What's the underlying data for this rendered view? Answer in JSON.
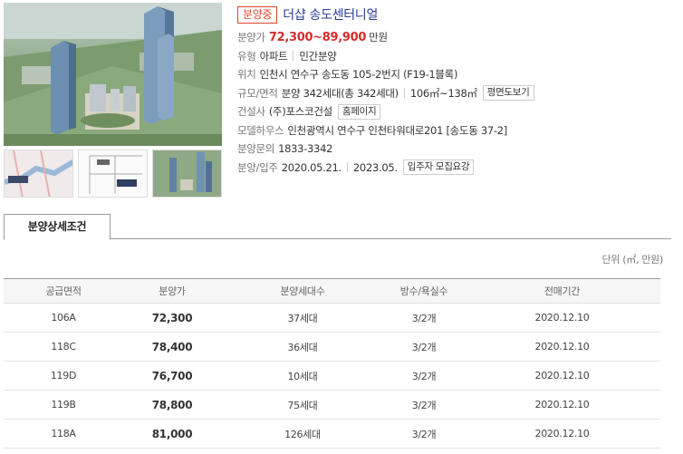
{
  "header": {
    "status_badge": "분양중",
    "title": "더샵 송도센터니얼"
  },
  "info": {
    "price": {
      "label": "분양가",
      "value": "72,300~89,900",
      "unit": "만원"
    },
    "type": {
      "label": "유형",
      "value1": "아파트",
      "value2": "민간분양"
    },
    "location": {
      "label": "위치",
      "value": "인천시 연수구 송도동 105-2번지 (F19-1블록)"
    },
    "scale": {
      "label": "규모/면적",
      "value1": "분양 342세대(총 342세대)",
      "value2": "106㎡~138㎡",
      "button": "평면도보기"
    },
    "builder": {
      "label": "건설사",
      "value": "(주)포스코건설",
      "button": "홈페이지"
    },
    "model_house": {
      "label": "모델하우스",
      "value": "인천광역시 연수구 인천타워대로201 [송도동 37-2]"
    },
    "inquiry": {
      "label": "분양문의",
      "value": "1833-3342"
    },
    "schedule": {
      "label": "분양/입주",
      "value1": "2020.05.21.",
      "value2": "2023.05.",
      "button": "입주자 모집요강"
    }
  },
  "tabs": [
    {
      "label": "분양상세조건"
    }
  ],
  "unit_note": "단위 (㎡, 만원)",
  "table": {
    "headers": [
      "공급면적",
      "분양가",
      "분양세대수",
      "방수/욕실수",
      "전매기간"
    ],
    "rows": [
      [
        "106A",
        "72,300",
        "37세대",
        "3/2개",
        "2020.12.10"
      ],
      [
        "118C",
        "78,400",
        "36세대",
        "3/2개",
        "2020.12.10"
      ],
      [
        "119D",
        "76,700",
        "10세대",
        "3/2개",
        "2020.12.10"
      ],
      [
        "119B",
        "78,800",
        "75세대",
        "3/2개",
        "2020.12.10"
      ],
      [
        "118A",
        "81,000",
        "126세대",
        "3/2개",
        "2020.12.10"
      ]
    ]
  },
  "colors": {
    "status": "#e0452c",
    "title": "#2a3a9a",
    "price": "#d42c2c"
  }
}
